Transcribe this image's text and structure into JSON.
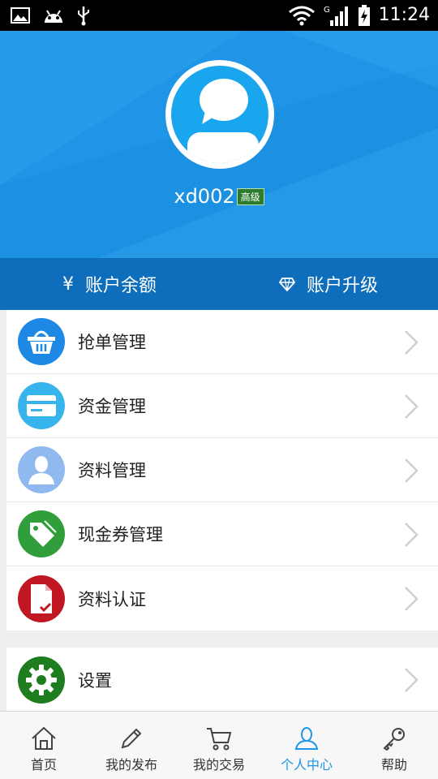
{
  "status_bar": {
    "time": "11:24"
  },
  "profile": {
    "username": "xd002",
    "level": "高级"
  },
  "account": {
    "balance_label": "账户余额",
    "upgrade_label": "账户升级",
    "yen_symbol": "¥"
  },
  "menu": [
    {
      "label": "抢单管理",
      "icon": "basket-icon",
      "color": "#1e88e5"
    },
    {
      "label": "资金管理",
      "icon": "card-icon",
      "color": "#37b4ec"
    },
    {
      "label": "资料管理",
      "icon": "user-icon",
      "color": "#90b9ef"
    },
    {
      "label": "现金券管理",
      "icon": "tag-icon",
      "color": "#2f9e3b"
    },
    {
      "label": "资料认证",
      "icon": "document-check-icon",
      "color": "#c01722"
    }
  ],
  "settings": {
    "label": "设置",
    "icon": "gear-icon",
    "color": "#1e7d1e"
  },
  "bottom_nav": [
    {
      "label": "首页",
      "icon": "home-icon"
    },
    {
      "label": "我的发布",
      "icon": "pencil-icon"
    },
    {
      "label": "我的交易",
      "icon": "cart-icon"
    },
    {
      "label": "个人中心",
      "icon": "person-icon",
      "active": true
    },
    {
      "label": "帮助",
      "icon": "key-icon"
    }
  ],
  "colors": {
    "primary": "#1e95e6",
    "account_bar": "#0f6ebb",
    "active_tab": "#1e95e6"
  }
}
